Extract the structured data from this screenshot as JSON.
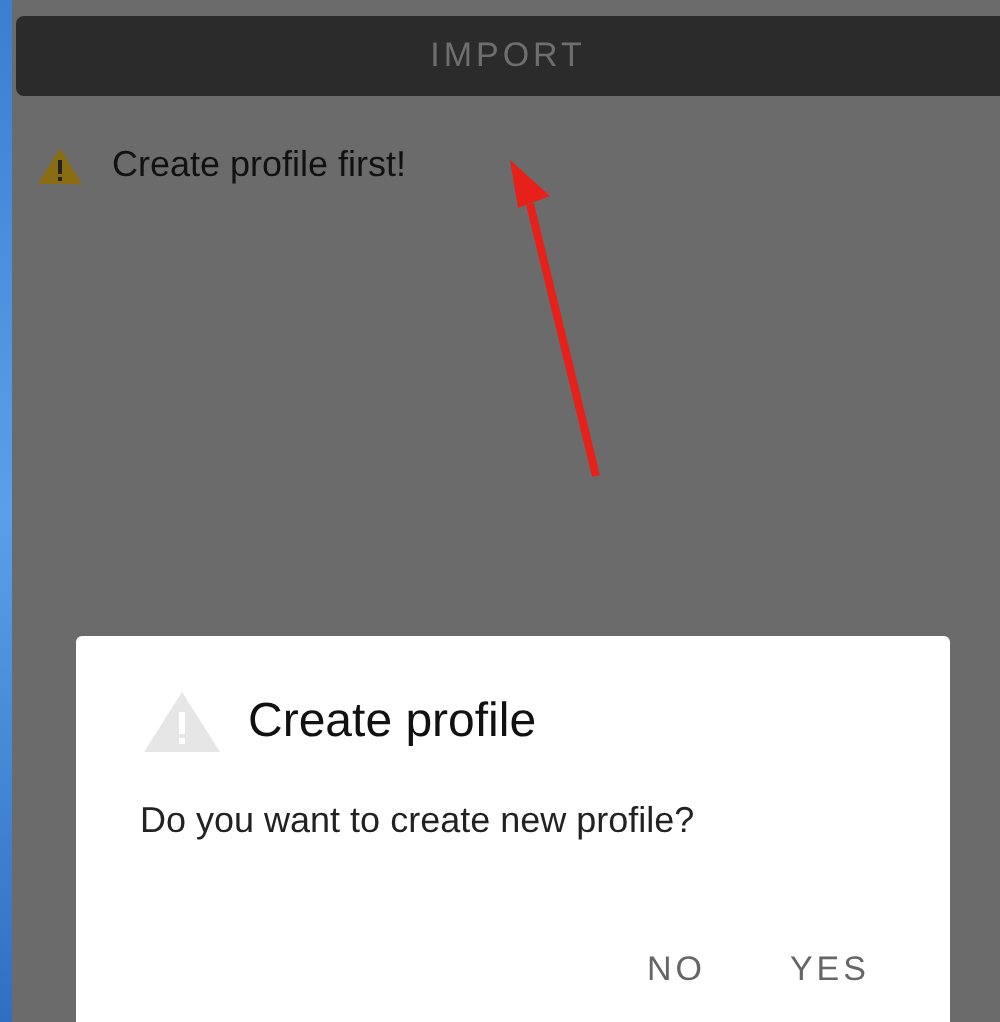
{
  "import_button": {
    "label": "IMPORT",
    "disabled": true
  },
  "warning": {
    "text": "Create profile first!"
  },
  "dialog": {
    "title": "Create profile",
    "message": "Do you want to create new profile?",
    "buttons": [
      {
        "label": "NO"
      },
      {
        "label": "YES"
      }
    ]
  }
}
